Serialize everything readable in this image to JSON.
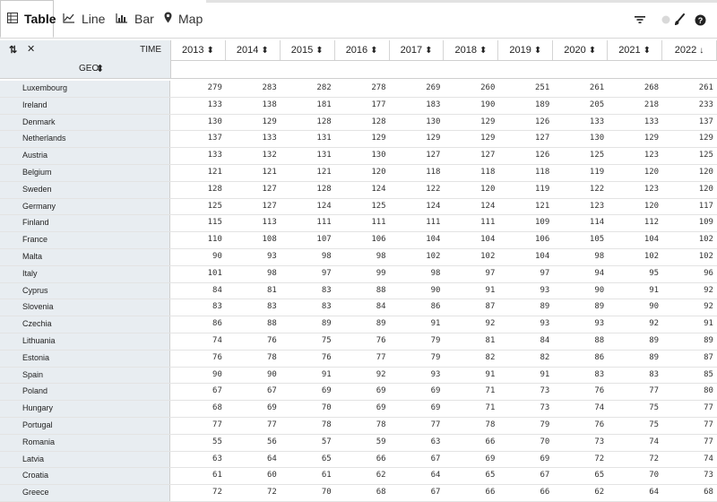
{
  "tabs": [
    {
      "label": "Table",
      "icon": "table-icon"
    },
    {
      "label": "Line",
      "icon": "line-chart-icon"
    },
    {
      "label": "Bar",
      "icon": "bar-chart-icon"
    },
    {
      "label": "Map",
      "icon": "map-pin-icon"
    }
  ],
  "header": {
    "time_label": "TIME",
    "geo_label": "GEO",
    "sort_glyph": "⬍",
    "desc_glyph": "↓",
    "years": [
      "2013",
      "2014",
      "2015",
      "2016",
      "2017",
      "2018",
      "2019",
      "2020",
      "2021",
      "2022"
    ]
  },
  "rows": [
    {
      "geo": "Luxembourg",
      "values": [
        "279",
        "283",
        "282",
        "278",
        "269",
        "260",
        "251",
        "261",
        "268",
        "261"
      ]
    },
    {
      "geo": "Ireland",
      "values": [
        "133",
        "138",
        "181",
        "177",
        "183",
        "190",
        "189",
        "205",
        "218",
        "233"
      ]
    },
    {
      "geo": "Denmark",
      "values": [
        "130",
        "129",
        "128",
        "128",
        "130",
        "129",
        "126",
        "133",
        "133",
        "137"
      ]
    },
    {
      "geo": "Netherlands",
      "values": [
        "137",
        "133",
        "131",
        "129",
        "129",
        "129",
        "127",
        "130",
        "129",
        "129"
      ]
    },
    {
      "geo": "Austria",
      "values": [
        "133",
        "132",
        "131",
        "130",
        "127",
        "127",
        "126",
        "125",
        "123",
        "125"
      ]
    },
    {
      "geo": "Belgium",
      "values": [
        "121",
        "121",
        "121",
        "120",
        "118",
        "118",
        "118",
        "119",
        "120",
        "120"
      ]
    },
    {
      "geo": "Sweden",
      "values": [
        "128",
        "127",
        "128",
        "124",
        "122",
        "120",
        "119",
        "122",
        "123",
        "120"
      ]
    },
    {
      "geo": "Germany",
      "values": [
        "125",
        "127",
        "124",
        "125",
        "124",
        "124",
        "121",
        "123",
        "120",
        "117"
      ]
    },
    {
      "geo": "Finland",
      "values": [
        "115",
        "113",
        "111",
        "111",
        "111",
        "111",
        "109",
        "114",
        "112",
        "109"
      ]
    },
    {
      "geo": "France",
      "values": [
        "110",
        "108",
        "107",
        "106",
        "104",
        "104",
        "106",
        "105",
        "104",
        "102"
      ]
    },
    {
      "geo": "Malta",
      "values": [
        "90",
        "93",
        "98",
        "98",
        "102",
        "102",
        "104",
        "98",
        "102",
        "102"
      ]
    },
    {
      "geo": "Italy",
      "values": [
        "101",
        "98",
        "97",
        "99",
        "98",
        "97",
        "97",
        "94",
        "95",
        "96"
      ]
    },
    {
      "geo": "Cyprus",
      "values": [
        "84",
        "81",
        "83",
        "88",
        "90",
        "91",
        "93",
        "90",
        "91",
        "92"
      ]
    },
    {
      "geo": "Slovenia",
      "values": [
        "83",
        "83",
        "83",
        "84",
        "86",
        "87",
        "89",
        "89",
        "90",
        "92"
      ]
    },
    {
      "geo": "Czechia",
      "values": [
        "86",
        "88",
        "89",
        "89",
        "91",
        "92",
        "93",
        "93",
        "92",
        "91"
      ]
    },
    {
      "geo": "Lithuania",
      "values": [
        "74",
        "76",
        "75",
        "76",
        "79",
        "81",
        "84",
        "88",
        "89",
        "89"
      ]
    },
    {
      "geo": "Estonia",
      "values": [
        "76",
        "78",
        "76",
        "77",
        "79",
        "82",
        "82",
        "86",
        "89",
        "87"
      ]
    },
    {
      "geo": "Spain",
      "values": [
        "90",
        "90",
        "91",
        "92",
        "93",
        "91",
        "91",
        "83",
        "83",
        "85"
      ]
    },
    {
      "geo": "Poland",
      "values": [
        "67",
        "67",
        "69",
        "69",
        "69",
        "71",
        "73",
        "76",
        "77",
        "80"
      ]
    },
    {
      "geo": "Hungary",
      "values": [
        "68",
        "69",
        "70",
        "69",
        "69",
        "71",
        "73",
        "74",
        "75",
        "77"
      ]
    },
    {
      "geo": "Portugal",
      "values": [
        "77",
        "77",
        "78",
        "78",
        "77",
        "78",
        "79",
        "76",
        "75",
        "77"
      ]
    },
    {
      "geo": "Romania",
      "values": [
        "55",
        "56",
        "57",
        "59",
        "63",
        "66",
        "70",
        "73",
        "74",
        "77"
      ]
    },
    {
      "geo": "Latvia",
      "values": [
        "63",
        "64",
        "65",
        "66",
        "67",
        "69",
        "69",
        "72",
        "72",
        "74"
      ]
    },
    {
      "geo": "Croatia",
      "values": [
        "61",
        "60",
        "61",
        "62",
        "64",
        "65",
        "67",
        "65",
        "70",
        "73"
      ]
    },
    {
      "geo": "Greece",
      "values": [
        "72",
        "72",
        "70",
        "68",
        "67",
        "66",
        "66",
        "62",
        "64",
        "68"
      ]
    }
  ]
}
